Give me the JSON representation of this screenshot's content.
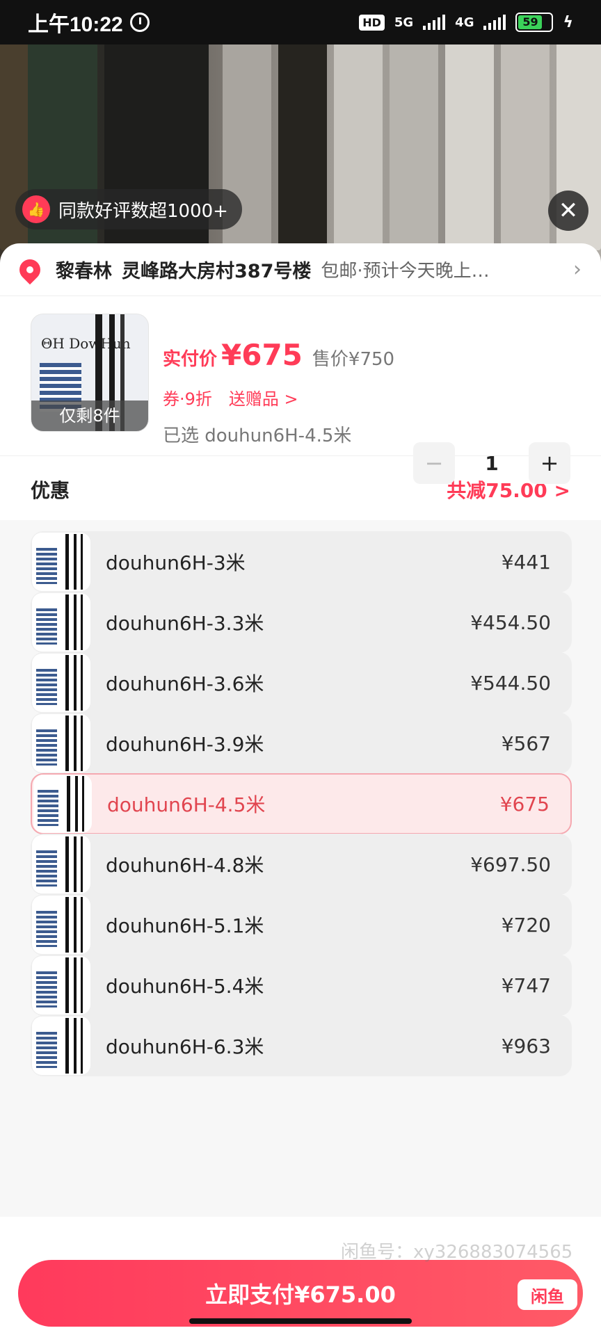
{
  "status_bar": {
    "time": "上午10:22",
    "network_hd": "HD",
    "network_5g": "5G",
    "network_4g": "4G",
    "battery": "59"
  },
  "banner": {
    "review_text": "同款好评数超1000+"
  },
  "address": {
    "name": "黎春林",
    "text": "灵峰路大房村387号楼",
    "shipping": "包邮·预计今天晚上…"
  },
  "product": {
    "stock_label": "仅剩8件",
    "price_label": "实付价",
    "price_value": "¥675",
    "original_price": "售价¥750",
    "coupon": "券·9折",
    "gift": "送赠品 >",
    "selected": "已选 douhun6H-4.5米",
    "quantity": "1",
    "minus": "−",
    "plus": "+",
    "image_logo": "ΘH DowHun"
  },
  "discount": {
    "label": "优惠",
    "value": "共减75.00 >"
  },
  "variants": [
    {
      "name": "douhun6H-3米",
      "price": "¥441"
    },
    {
      "name": "douhun6H-3.3米",
      "price": "¥454.50"
    },
    {
      "name": "douhun6H-3.6米",
      "price": "¥544.50"
    },
    {
      "name": "douhun6H-3.9米",
      "price": "¥567"
    },
    {
      "name": "douhun6H-4.5米",
      "price": "¥675"
    },
    {
      "name": "douhun6H-4.8米",
      "price": "¥697.50"
    },
    {
      "name": "douhun6H-5.1米",
      "price": "¥720"
    },
    {
      "name": "douhun6H-5.4米",
      "price": "¥747"
    },
    {
      "name": "douhun6H-6.3米",
      "price": "¥963"
    }
  ],
  "selected_variant_index": 4,
  "pay_button": {
    "label": "立即支付¥675.00",
    "logo": "闲鱼"
  },
  "watermark": "闲鱼号：xy3268830745​65",
  "colors": {
    "accent": "#ff3b57",
    "selected_bg": "#fde9ea"
  },
  "icons": {
    "thumb": "thumbs-up-icon",
    "close": "close-icon",
    "pin": "location-pin-icon",
    "chevron": "chevron-right-icon"
  }
}
